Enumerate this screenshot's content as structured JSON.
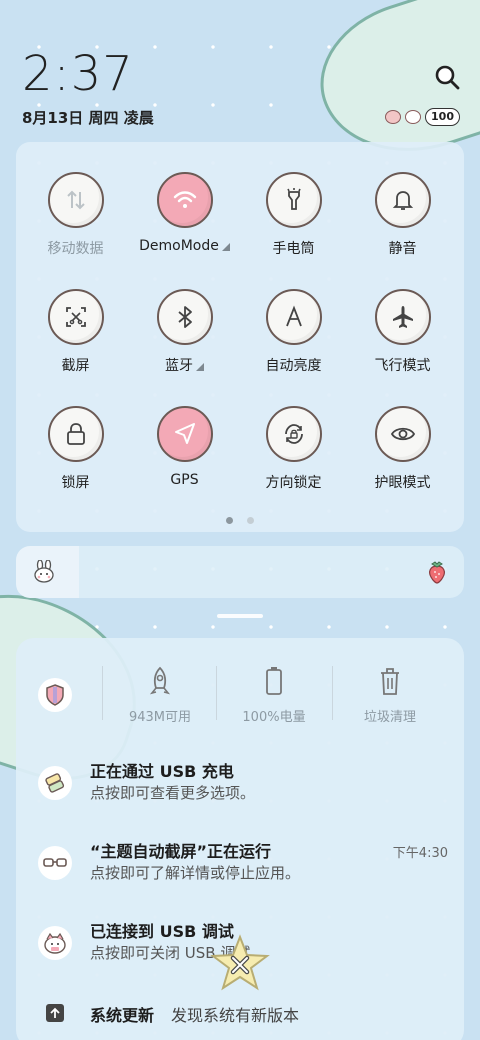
{
  "lockscreen": {
    "time": "2:37",
    "date": "8月13日 周四 凌晨",
    "battery": "100"
  },
  "quick_settings": {
    "tiles": [
      {
        "label": "移动数据",
        "icon": "mobile-data-icon",
        "active": false,
        "dim": true
      },
      {
        "label": "DemoMode",
        "icon": "wifi-icon",
        "active": true,
        "caret": true
      },
      {
        "label": "手电筒",
        "icon": "flashlight-icon",
        "active": false
      },
      {
        "label": "静音",
        "icon": "bell-icon",
        "active": false
      },
      {
        "label": "截屏",
        "icon": "screenshot-icon",
        "active": false
      },
      {
        "label": "蓝牙",
        "icon": "bluetooth-icon",
        "active": false,
        "caret": true
      },
      {
        "label": "自动亮度",
        "icon": "auto-brightness-icon",
        "active": false
      },
      {
        "label": "飞行模式",
        "icon": "airplane-icon",
        "active": false
      },
      {
        "label": "锁屏",
        "icon": "lock-icon",
        "active": false
      },
      {
        "label": "GPS",
        "icon": "location-icon",
        "active": true
      },
      {
        "label": "方向锁定",
        "icon": "rotation-lock-icon",
        "active": false
      },
      {
        "label": "护眼模式",
        "icon": "eye-icon",
        "active": false
      }
    ],
    "page_count": 2,
    "current_page": 1
  },
  "brightness": {
    "level": 0.14
  },
  "shortcuts": [
    {
      "label": "943M可用",
      "icon": "rocket-icon"
    },
    {
      "label": "100%电量",
      "icon": "battery-icon"
    },
    {
      "label": "垃圾清理",
      "icon": "trash-icon"
    }
  ],
  "notifications": [
    {
      "title": "正在通过 USB 充电",
      "body": "点按即可查看更多选项。",
      "time": ""
    },
    {
      "title": "“主题自动截屏”正在运行",
      "body": "点按即可了解详情或停止应用。",
      "time": "下午4:30"
    },
    {
      "title": "已连接到 USB 调试",
      "body": "点按即可关闭 USB 调试",
      "time": ""
    }
  ],
  "system_update": {
    "title": "系统更新",
    "body": "发现系统有新版本"
  },
  "colors": {
    "wallpaper": "#c9e1f2",
    "tile_on": "#f3a9b6",
    "tile_border": "#6b5a55"
  }
}
